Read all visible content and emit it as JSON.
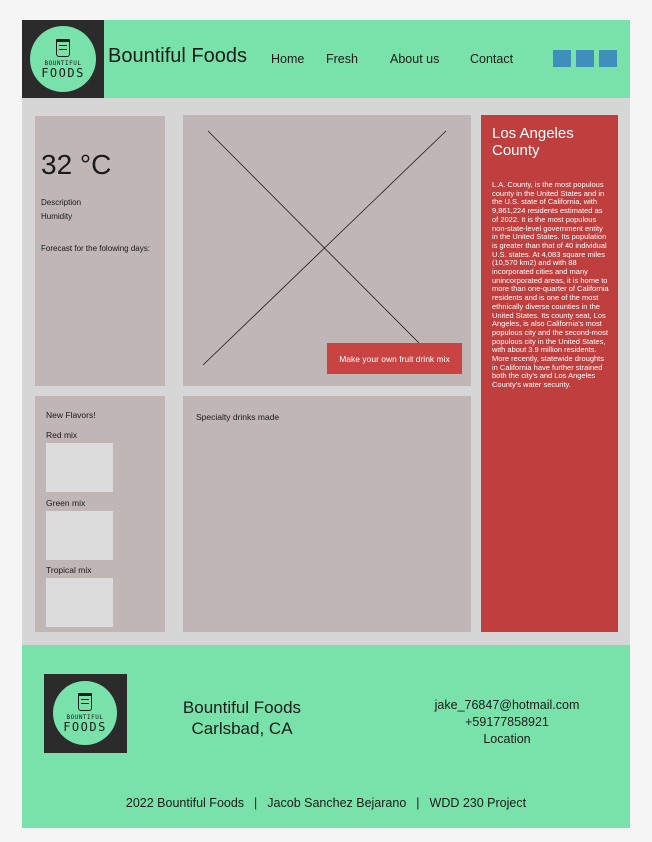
{
  "header": {
    "logo": {
      "line1": "BOUNTIFUL",
      "line2": "FOODS",
      "icon": "cup-icon"
    },
    "brand": "Bountiful Foods",
    "nav": [
      "Home",
      "Fresh",
      "About us",
      "Contact"
    ],
    "social_color": "#3e8fbc"
  },
  "weather": {
    "temperature": "32 °C",
    "description": "Description",
    "humidity": "Humidity",
    "forecast": "Forecast for the folowing days:"
  },
  "hero": {
    "image": "placeholder-image",
    "button": "Make your own fruit drink mix"
  },
  "flavors": {
    "title": "New Flavors!",
    "items": [
      "Red mix",
      "Green mix",
      "Tropical mix"
    ]
  },
  "specialty": {
    "title": "Specialty drinks made"
  },
  "la": {
    "title": "Los Angeles County",
    "body": "L.A. County, is the most populous county in the United States and in the U.S. state of California, with 9,861,224 residents estimated as of 2022. It is the most populous non-state-level government entity in the United States. Its population is greater than that of 40 individual U.S. states. At 4,083 square miles (10,570 km2) and with 88 incorporated cities and many unincorporated areas, it is home to more than one-quarter of California residents and is one of the most ethnically diverse counties in the United States. Its county seat, Los Angeles, is also California's most populous city and the second-most populous city in the United States, with about 3.9 million residents. More recently, statewide droughts in California have further strained both the city's and Los Angeles County's water security."
  },
  "footer": {
    "logo": {
      "line1": "BOUNTIFUL",
      "line2": "FOODS"
    },
    "name": "Bountiful Foods",
    "city": "Carlsbad, CA",
    "email": "jake_76847@hotmail.com",
    "phone": "+59177858921",
    "location": "Location",
    "bottom": [
      "2022 Bountiful Foods",
      "Jacob Sanchez Bejarano",
      "WDD 230 Project"
    ],
    "separator": "|"
  },
  "colors": {
    "accent_green": "#79e2aa",
    "panel_gray": "#bfb6b5",
    "la_red": "#bf3f3f",
    "button_red": "#c94343",
    "background": "#d6d6d6"
  }
}
